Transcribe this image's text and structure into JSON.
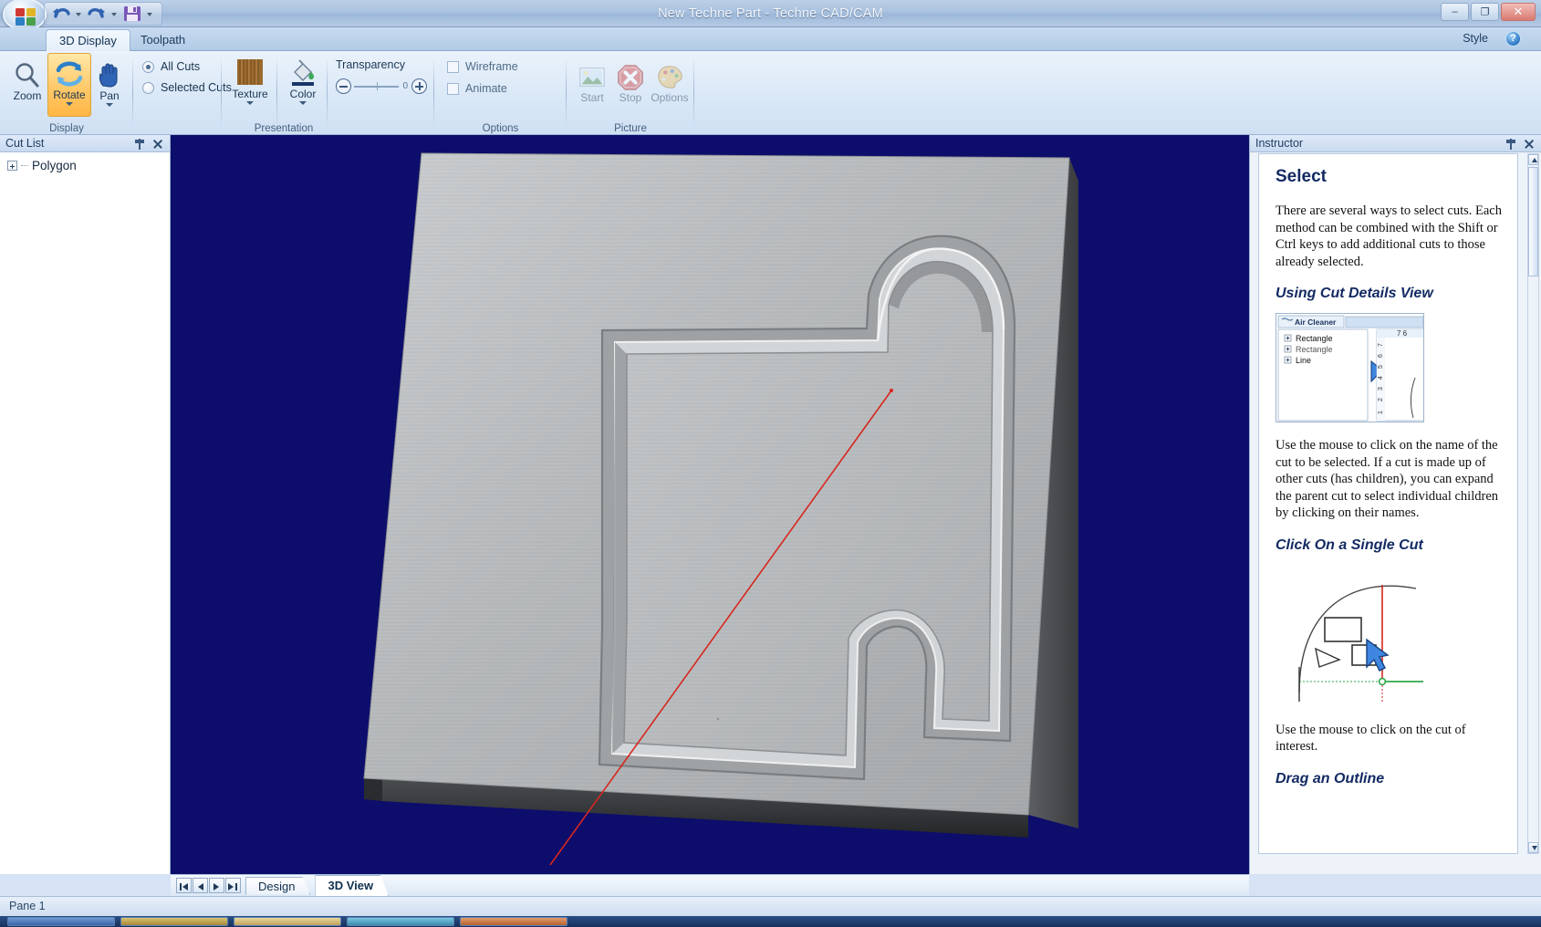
{
  "window": {
    "title": "New Techne Part - Techne CAD/CAM",
    "minimize_label": "–",
    "maximize_label": "❐",
    "close_label": "✕",
    "orb_name": "application-menu"
  },
  "quick_access": {
    "items": [
      {
        "name": "undo-button",
        "label": "Undo"
      },
      {
        "name": "undo-dropdown",
        "label": "Undo history"
      },
      {
        "name": "redo-button",
        "label": "Redo"
      },
      {
        "name": "redo-dropdown",
        "label": "Redo history"
      },
      {
        "name": "save-button",
        "label": "Save"
      },
      {
        "name": "customize-qat",
        "label": "Customize Quick Access Toolbar"
      }
    ]
  },
  "ribbon": {
    "tabs": [
      {
        "label": "3D Display",
        "active": true
      },
      {
        "label": "Toolpath",
        "active": false
      }
    ],
    "style_label": "Style",
    "help_label": "?",
    "groups": [
      {
        "title": "Display",
        "buttons": [
          {
            "label": "Zoom",
            "icon": "magnifier-icon",
            "selected": false,
            "dropdown": false
          },
          {
            "label": "Rotate",
            "icon": "rotate-arrows-icon",
            "selected": true,
            "dropdown": true
          },
          {
            "label": "Pan",
            "icon": "hand-icon",
            "selected": false,
            "dropdown": true
          }
        ]
      },
      {
        "title": "Presentation",
        "radios": [
          {
            "label": "All Cuts",
            "checked": true
          },
          {
            "label": "Selected Cuts",
            "checked": false
          }
        ],
        "buttons": [
          {
            "label": "Texture",
            "icon": "wood-texture-icon",
            "dropdown": true
          },
          {
            "label": "Color",
            "icon": "paint-bucket-icon",
            "dropdown": true
          }
        ],
        "slider": {
          "title": "Transparency",
          "minus_label": "−",
          "plus_label": "+",
          "value": "0"
        }
      },
      {
        "title": "Options",
        "checkboxes": [
          {
            "label": "Wireframe",
            "checked": false
          },
          {
            "label": "Animate",
            "checked": false
          }
        ]
      },
      {
        "title": "Picture",
        "buttons": [
          {
            "label": "Start",
            "icon": "picture-icon",
            "disabled": true
          },
          {
            "label": "Stop",
            "icon": "stop-sign-icon",
            "disabled": true
          },
          {
            "label": "Options",
            "icon": "palette-icon",
            "disabled": true
          }
        ]
      }
    ]
  },
  "cut_list": {
    "title": "Cut List",
    "pin_label": "Auto Hide",
    "close_label": "Close",
    "items": [
      {
        "label": "Polygon",
        "expanded": false
      }
    ]
  },
  "viewport": {
    "background_color": "#0d0d6b",
    "material_color": "#b9bcbe",
    "nav_buttons": [
      {
        "name": "first-record-button",
        "label": "|◀"
      },
      {
        "name": "previous-record-button",
        "label": "◀"
      },
      {
        "name": "next-record-button",
        "label": "▶"
      },
      {
        "name": "last-record-button",
        "label": "▶|"
      }
    ],
    "tabs": [
      {
        "label": "Design",
        "active": false
      },
      {
        "label": "3D View",
        "active": true
      }
    ]
  },
  "instructor": {
    "title": "Instructor",
    "pin_label": "Auto Hide",
    "close_label": "Close",
    "heading": "Select",
    "paragraph1": "There are several ways to select cuts. Each method can be combined with the Shift or Ctrl keys to add additional cuts to those already selected.",
    "subheading1": "Using Cut Details View",
    "figure1": {
      "tab_label": "Air Cleaner",
      "tree_items": [
        "Rectangle",
        "Rectangle",
        "Line"
      ],
      "ruler_top": "7 6",
      "ruler_side": "1 2 3 4 5 6 7"
    },
    "paragraph2": "Use the mouse to click on the name of the cut to be selected.  If a cut is made up of other cuts (has children), you can expand the parent cut to select individual children by clicking on their names.",
    "subheading2": "Click On a Single Cut",
    "paragraph3": "Use the mouse to click on the cut of interest.",
    "subheading3": "Drag an Outline"
  },
  "status_bar": {
    "text": "Pane 1"
  }
}
